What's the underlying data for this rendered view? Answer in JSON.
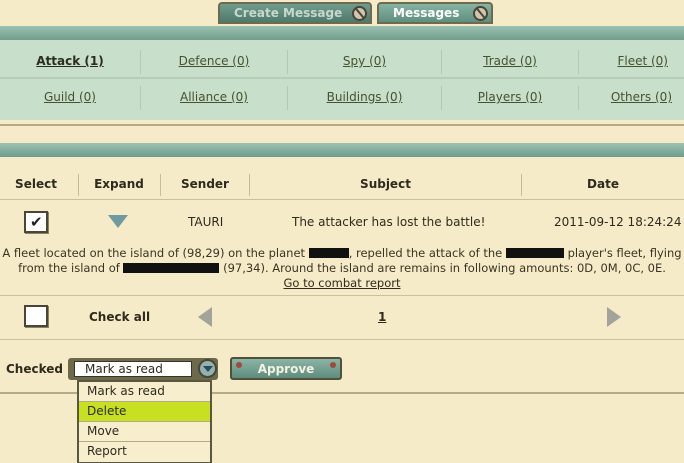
{
  "tabs": {
    "create_message": "Create Message",
    "messages": "Messages"
  },
  "categories": {
    "row1": [
      "Attack (1)",
      "Defence (0)",
      "Spy (0)",
      "Trade (0)",
      "Fleet (0)"
    ],
    "row2": [
      "Guild (0)",
      "Alliance (0)",
      "Buildings (0)",
      "Players (0)",
      "Others (0)"
    ],
    "active": "Attack (1)"
  },
  "table": {
    "headers": {
      "select": "Select",
      "expand": "Expand",
      "sender": "Sender",
      "subject": "Subject",
      "date": "Date"
    },
    "message": {
      "checked": true,
      "sender": "TAURI",
      "subject": "The attacker has lost the battle!",
      "date": "2011-09-12 18:24:24",
      "body_part1": "A fleet located on the island of (98,29) on the planet",
      "body_part2": ", repelled the attack of the",
      "body_part3": "player's fleet, flying",
      "body_part4": "from the island of",
      "body_part5": "(97,34). Around the island are remains in following amounts: 0D, 0M, 0C, 0E.",
      "combat_link": "Go to combat report"
    }
  },
  "footer": {
    "check_all": "Check all",
    "page": "1"
  },
  "actions": {
    "checked_label": "Checked",
    "selected": "Mark as read",
    "approve": "Approve",
    "options": [
      "Mark as read",
      "Delete",
      "Move",
      "Report"
    ],
    "highlighted": "Delete"
  },
  "colors": {
    "background": "#f5ebc8",
    "teal_bar": "#7fa999",
    "category_bg": "#c7dfcb",
    "highlight": "#c7e022"
  }
}
